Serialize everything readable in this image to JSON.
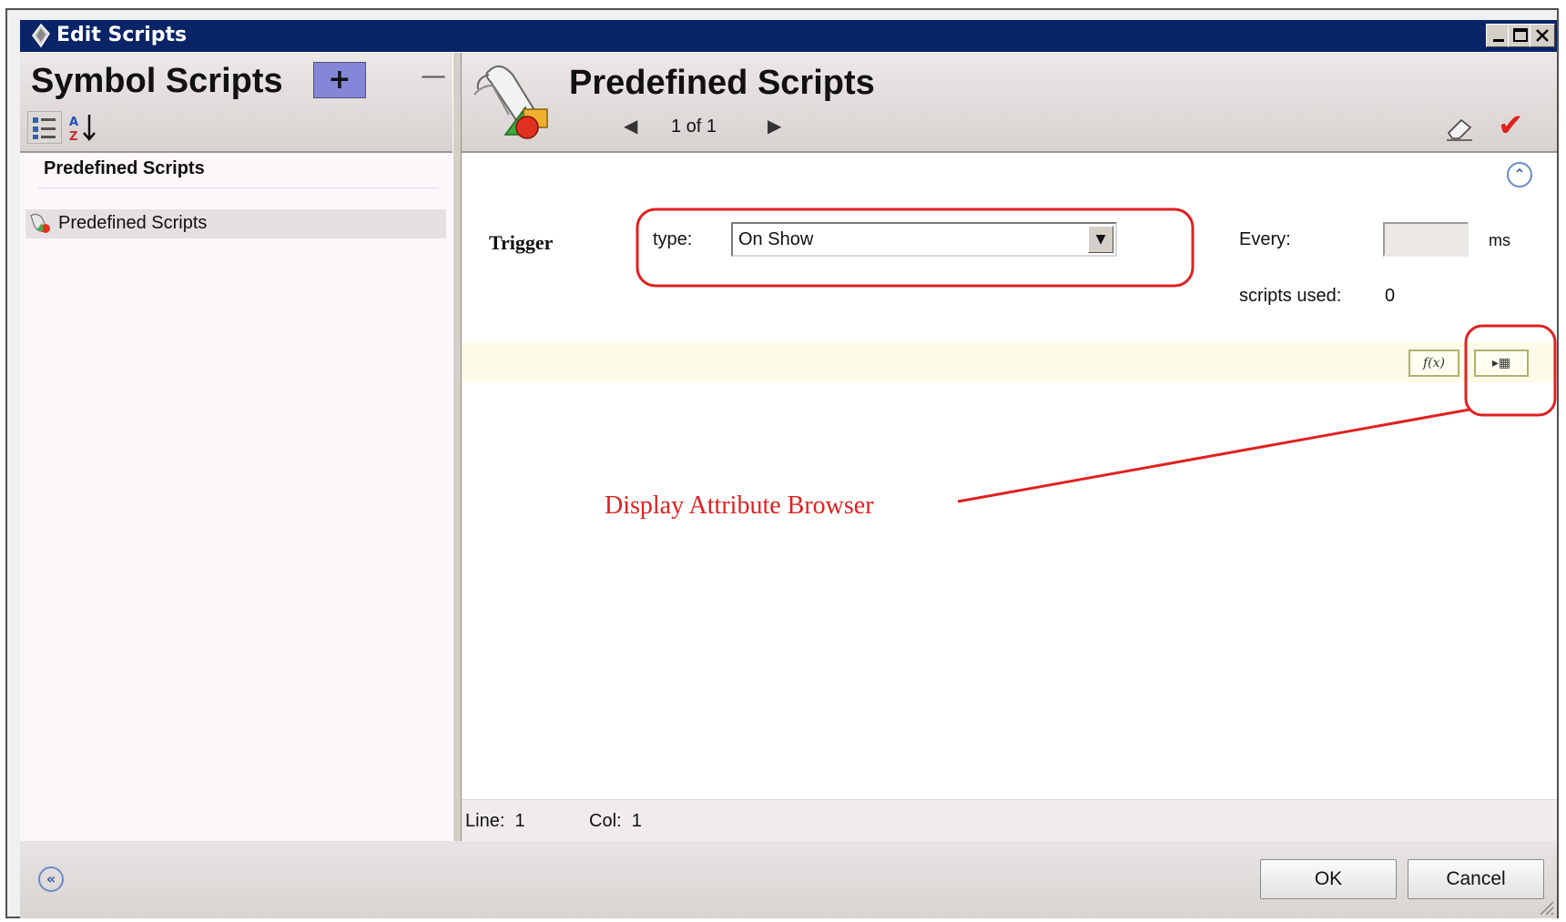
{
  "window": {
    "title": "Edit Scripts",
    "controls": [
      "minimize",
      "maximize",
      "close"
    ]
  },
  "left_panel": {
    "title": "Symbol Scripts",
    "add_label": "+",
    "remove_label": "—",
    "sort_az_label": "A Z",
    "section_title": "Predefined Scripts",
    "tree_items": [
      {
        "label": "Predefined Scripts",
        "icon": "script-icon",
        "selected": true
      }
    ]
  },
  "right_panel": {
    "title": "Predefined Scripts",
    "pager": {
      "prev": "◀",
      "text": "1 of 1",
      "next": "▶"
    },
    "trigger_label": "Trigger",
    "type_label": "type:",
    "type_value": "On Show",
    "every_label": "Every:",
    "every_value": "",
    "ms_label": "ms",
    "scripts_used_label": "scripts used:",
    "scripts_used_value": "0",
    "fx_label": "f(x)",
    "attr_browser_label": "▸▦",
    "status": {
      "line_label": "Line:",
      "line_value": "1",
      "col_label": "Col:",
      "col_value": "1"
    }
  },
  "annotation": {
    "text": "Display Attribute Browser",
    "color": "#e02020"
  },
  "footer": {
    "ok_label": "OK",
    "cancel_label": "Cancel"
  },
  "colors": {
    "titlebar": "#0a2468",
    "add_button": "#8486d8",
    "annotation": "#e02020"
  }
}
